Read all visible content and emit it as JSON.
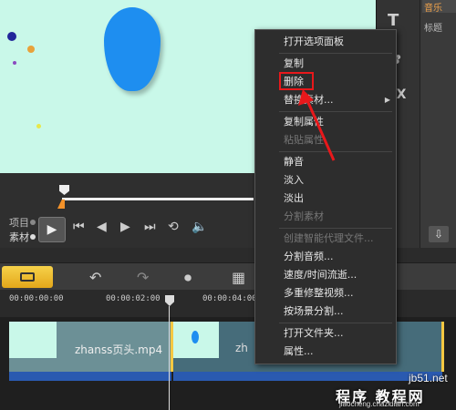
{
  "right_panel": {
    "tab_music": "音乐",
    "tab_title": "标题"
  },
  "playback": {
    "project_label": "项目",
    "clip_label": "素材"
  },
  "timeline": {
    "ticks": [
      "00:00:00:00",
      "00:00:02:00",
      "00:00:04:00"
    ],
    "clip1_name": "zhanss页头.mp4",
    "clip2_name": "zh"
  },
  "context_menu": {
    "items": [
      {
        "label": "打开选项面板",
        "enabled": true
      },
      {
        "label": "复制",
        "enabled": true
      },
      {
        "label": "删除",
        "enabled": true,
        "highlighted": true
      },
      {
        "label": "替换素材...",
        "enabled": true,
        "submenu": true
      },
      {
        "label": "复制属性",
        "enabled": true
      },
      {
        "label": "粘贴属性",
        "enabled": false
      },
      {
        "label": "静音",
        "enabled": true
      },
      {
        "label": "淡入",
        "enabled": true
      },
      {
        "label": "淡出",
        "enabled": true
      },
      {
        "label": "分割素材",
        "enabled": false
      },
      {
        "label": "创建智能代理文件...",
        "enabled": false
      },
      {
        "label": "分割音频...",
        "enabled": true
      },
      {
        "label": "速度/时间流逝...",
        "enabled": true
      },
      {
        "label": "多重修整视频...",
        "enabled": true
      },
      {
        "label": "按场景分割...",
        "enabled": true
      },
      {
        "label": "打开文件夹...",
        "enabled": true
      },
      {
        "label": "属性...",
        "enabled": true
      }
    ]
  },
  "watermark": {
    "site": "jb51.net",
    "brand": "程序 教程网",
    "url": "jiaocheng.chazidian.com"
  },
  "colors": {
    "preview_bg": "#c9f8e9",
    "blob": "#1e8ef0",
    "accent": "#f3922a",
    "highlight": "#e8181b"
  }
}
